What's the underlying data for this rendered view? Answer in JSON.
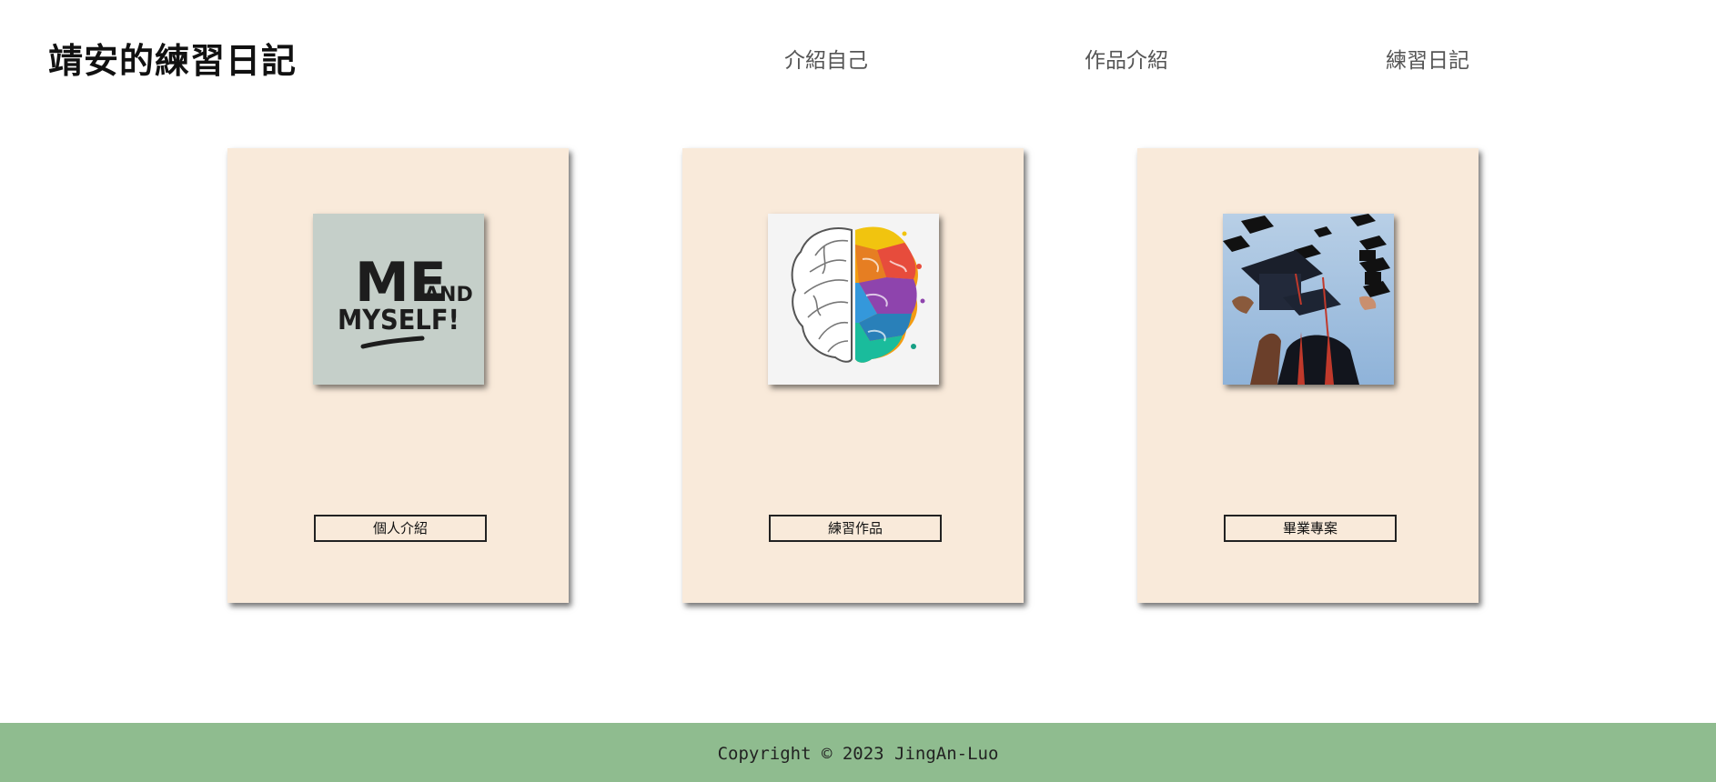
{
  "header": {
    "site_title": "靖安的練習日記",
    "nav": [
      {
        "label": "介紹自己"
      },
      {
        "label": "作品介紹"
      },
      {
        "label": "練習日記"
      }
    ]
  },
  "cards": [
    {
      "image": "me-and-myself-image",
      "image_text": [
        "ME",
        "AND",
        "MYSELF!"
      ],
      "button_label": "個人介紹"
    },
    {
      "image": "brain-left-right-image",
      "button_label": "練習作品"
    },
    {
      "image": "graduation-caps-image",
      "button_label": "畢業專案"
    }
  ],
  "footer": {
    "copyright": "Copyright © 2023 JingAn-Luo"
  },
  "colors": {
    "card_background": "#f9eada",
    "footer_background": "#8fbc8f",
    "me_image_background": "#c5cfc9"
  }
}
